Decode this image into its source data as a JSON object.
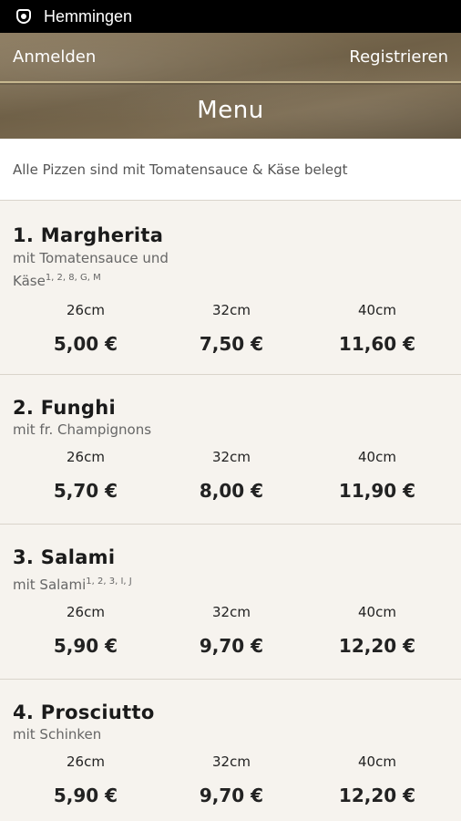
{
  "status_bar": {
    "title": "Hemmingen"
  },
  "header": {
    "login": "Anmelden",
    "register": "Registrieren",
    "title": "Menu"
  },
  "notice": "Alle Pizzen sind mit Tomatensauce & Käse belegt",
  "items": [
    {
      "name": "1. Margherita",
      "desc_line1": "mit Tomatensauce und",
      "desc_line2": "Käse",
      "desc_sup": "1, 2, 8, G, M",
      "sizes": [
        "26cm",
        "32cm",
        "40cm"
      ],
      "prices": [
        "5,00 €",
        "7,50 €",
        "11,60 €"
      ]
    },
    {
      "name": "2. Funghi",
      "desc_line1": "mit fr. Champignons",
      "sizes": [
        "26cm",
        "32cm",
        "40cm"
      ],
      "prices": [
        "5,70 €",
        "8,00 €",
        "11,90 €"
      ]
    },
    {
      "name": "3. Salami",
      "desc_line1": "mit Salami",
      "desc_sup": "1, 2, 3, I, J",
      "sizes": [
        "26cm",
        "32cm",
        "40cm"
      ],
      "prices": [
        "5,90 €",
        "9,70 €",
        "12,20 €"
      ]
    },
    {
      "name": "4. Prosciutto",
      "desc_line1": "mit Schinken",
      "sizes": [
        "26cm",
        "32cm",
        "40cm"
      ],
      "prices": [
        "5,90 €",
        "9,70 €",
        "12,20 €"
      ]
    }
  ]
}
